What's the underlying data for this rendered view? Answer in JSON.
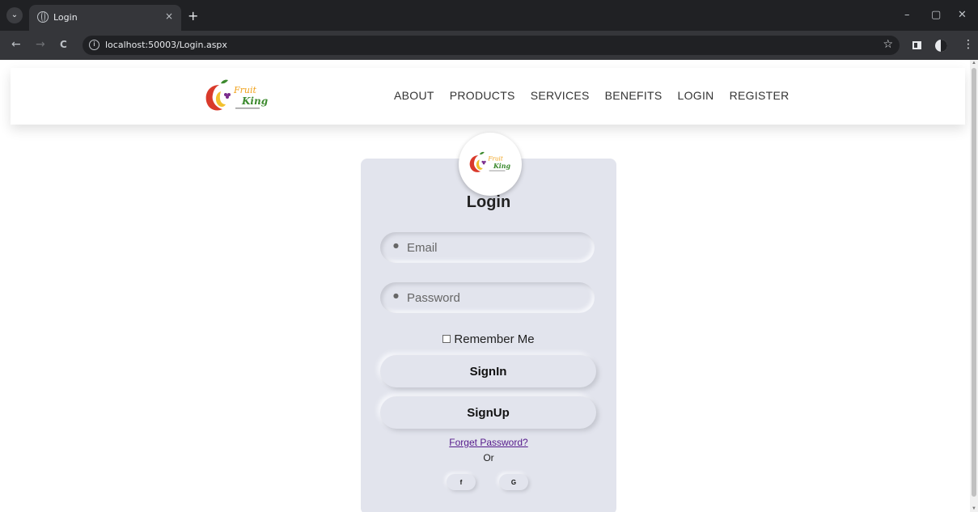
{
  "browser": {
    "tab_title": "Login",
    "url": "localhost:50003/Login.aspx",
    "new_tab": "+",
    "tab_close": "×",
    "back": "←",
    "forward": "→",
    "reload": "C",
    "star": "☆",
    "minimize": "–",
    "maximize": "▢",
    "close": "✕",
    "menu": "⋮",
    "search_tabs": "⌄"
  },
  "header": {
    "nav": [
      "ABOUT",
      "PRODUCTS",
      "SERVICES",
      "BENEFITS",
      "LOGIN",
      "REGISTER"
    ]
  },
  "logo": {
    "line1": "Fruit",
    "line2": "King",
    "colors": {
      "red": "#d93a2b",
      "orange": "#f0a21c",
      "green": "#3c8a2e",
      "yellow": "#f2c12e"
    }
  },
  "login": {
    "title": "Login",
    "email_placeholder": "Email",
    "password_placeholder": "Password",
    "email_icon": "user-icon",
    "password_icon": "lock-icon",
    "remember_label": "Remember Me",
    "signin_label": "SignIn",
    "signup_label": "SignUp",
    "forgot_label": "Forget Password?",
    "or_label": "Or",
    "facebook_label": "f",
    "google_label": "G"
  },
  "colors": {
    "card_bg": "#e2e4ed",
    "link": "#551a8b",
    "chrome_dark": "#202124"
  }
}
